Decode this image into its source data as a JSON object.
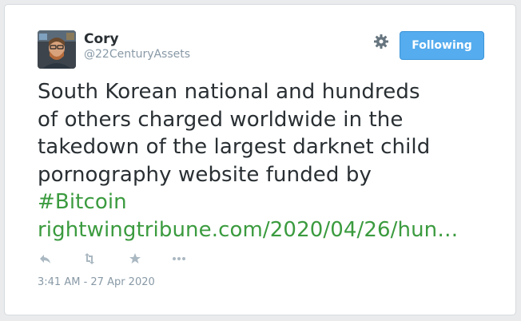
{
  "tweet": {
    "author": {
      "display_name": "Cory",
      "handle": "@22CenturyAssets"
    },
    "follow_button_label": "Following",
    "text_lines": [
      "South Korean national and hundreds",
      "of others charged worldwide in the",
      "takedown of the largest darknet child",
      "pornography website funded by"
    ],
    "hashtag": "#Bitcoin",
    "link": "rightwingtribune.com/2020/04/26/hun…",
    "timestamp": "3:41 AM - 27 Apr 2020",
    "actions": [
      "reply-icon",
      "retweet-icon",
      "favorite-icon",
      "more-icon"
    ],
    "icons": {
      "settings": "gear-icon"
    },
    "colors": {
      "link": "#3b9b3f",
      "follow_button": "#55acee",
      "text": "#292f33",
      "muted": "#8899a6"
    }
  }
}
